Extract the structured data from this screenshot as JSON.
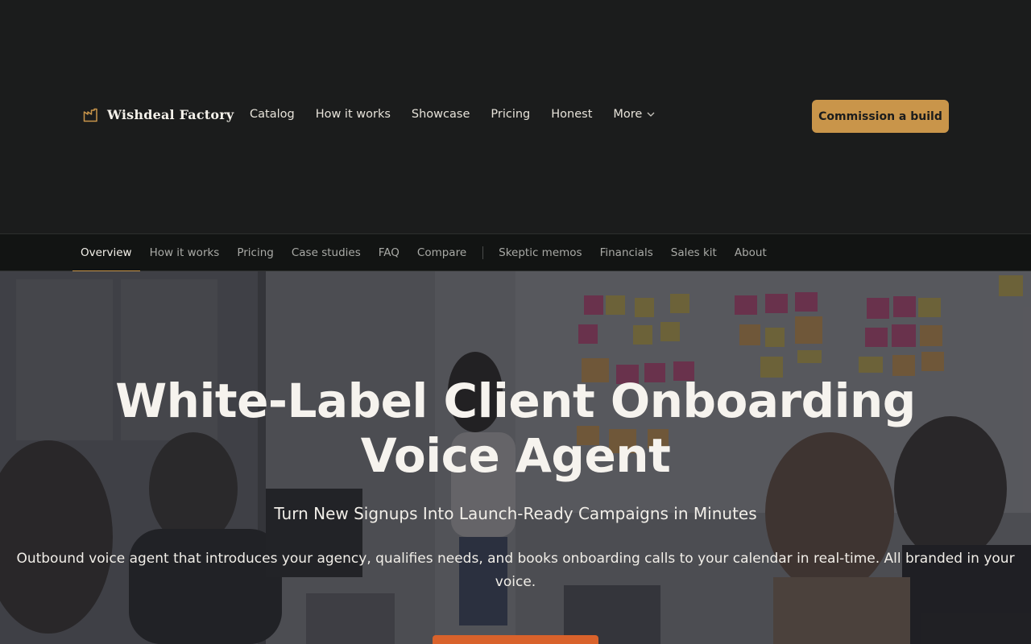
{
  "header": {
    "brand": "Wishdeal Factory",
    "nav": [
      {
        "label": "Catalog"
      },
      {
        "label": "How it works"
      },
      {
        "label": "Showcase"
      },
      {
        "label": "Pricing"
      },
      {
        "label": "Honest"
      },
      {
        "label": "More"
      }
    ],
    "cta_label": "Commission a build"
  },
  "subnav": {
    "tabs": [
      {
        "label": "Overview",
        "active": true
      },
      {
        "label": "How it works"
      },
      {
        "label": "Pricing"
      },
      {
        "label": "Case studies"
      },
      {
        "label": "FAQ"
      },
      {
        "label": "Compare"
      }
    ],
    "tabs_secondary": [
      {
        "label": "Skeptic memos"
      },
      {
        "label": "Financials"
      },
      {
        "label": "Sales kit"
      },
      {
        "label": "About"
      }
    ]
  },
  "hero": {
    "title": "White-Label Client Onboarding Voice Agent",
    "subtitle": "Turn New Signups Into Launch-Ready Campaigns in Minutes",
    "description": "Outbound voice agent that introduces your agency, qualifies needs, and books onboarding calls to your calendar in real-time. All branded in your voice."
  },
  "colors": {
    "background": "#1b1c1c",
    "accent": "#c9954a",
    "hero_button": "#d9622b"
  },
  "icons": {
    "brand": "factory-icon",
    "more": "chevron-down-icon"
  }
}
